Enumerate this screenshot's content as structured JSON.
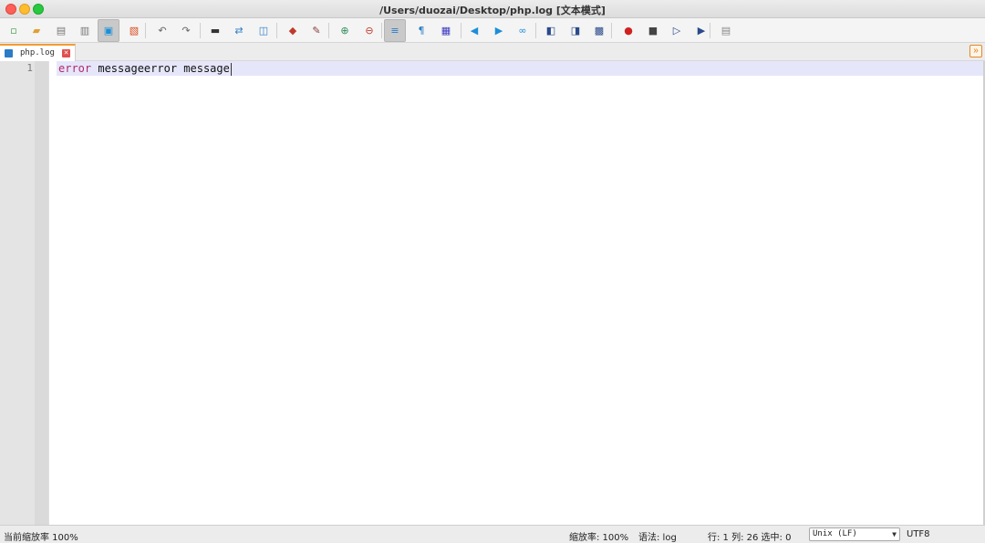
{
  "window": {
    "title": "/Users/duozai/Desktop/php.log [文本模式]"
  },
  "toolbar": {
    "buttons": [
      {
        "name": "new-file-icon",
        "glyph": "▫",
        "color": "#3a9a3a"
      },
      {
        "name": "open-file-icon",
        "glyph": "▰",
        "color": "#e0a030"
      },
      {
        "name": "save-icon",
        "glyph": "▤",
        "color": "#777777"
      },
      {
        "name": "save-all-icon",
        "glyph": "▥",
        "color": "#777777"
      },
      {
        "name": "close-file-icon",
        "glyph": "▣",
        "color": "#1b8fd8",
        "active": true
      },
      {
        "name": "close-all-icon",
        "glyph": "▧",
        "color": "#d84a20"
      },
      {
        "name": "undo-icon",
        "glyph": "↶",
        "color": "#666666"
      },
      {
        "name": "redo-icon",
        "glyph": "↷",
        "color": "#666666"
      },
      {
        "name": "print-icon",
        "glyph": "▬",
        "color": "#333333"
      },
      {
        "name": "find-replace-icon",
        "glyph": "⇄",
        "color": "#2a7cc7"
      },
      {
        "name": "bookmark-icon",
        "glyph": "◫",
        "color": "#2a7cc7"
      },
      {
        "name": "highlight-icon",
        "glyph": "◆",
        "color": "#c0392b"
      },
      {
        "name": "unmark-icon",
        "glyph": "✎",
        "color": "#8a3a3a"
      },
      {
        "name": "zoom-in-icon",
        "glyph": "⊕",
        "color": "#2e8b57"
      },
      {
        "name": "zoom-out-icon",
        "glyph": "⊖",
        "color": "#c0392b"
      },
      {
        "name": "word-wrap-icon",
        "glyph": "≡",
        "color": "#2a7cc7",
        "active": true
      },
      {
        "name": "show-all-chars-icon",
        "glyph": "¶",
        "color": "#2a7cc7"
      },
      {
        "name": "indent-guide-icon",
        "glyph": "▦",
        "color": "#3a3ac0"
      },
      {
        "name": "prev-icon",
        "glyph": "◀",
        "color": "#1b8fd8"
      },
      {
        "name": "next-icon",
        "glyph": "▶",
        "color": "#1b8fd8"
      },
      {
        "name": "goto-icon",
        "glyph": "∞",
        "color": "#1b8fd8"
      },
      {
        "name": "split-view-icon",
        "glyph": "◧",
        "color": "#2a4a8a"
      },
      {
        "name": "compare-icon",
        "glyph": "◨",
        "color": "#2a4a8a"
      },
      {
        "name": "sync-scroll-icon",
        "glyph": "▩",
        "color": "#2a4a8a"
      },
      {
        "name": "record-macro-icon",
        "glyph": "●",
        "color": "#d02020"
      },
      {
        "name": "stop-macro-icon",
        "glyph": "■",
        "color": "#444444"
      },
      {
        "name": "play-macro-icon",
        "glyph": "▷",
        "color": "#2a4a8a"
      },
      {
        "name": "run-macro-multiple-icon",
        "glyph": "▶",
        "color": "#2a4a8a"
      },
      {
        "name": "save-macro-icon",
        "glyph": "▤",
        "color": "#888888"
      }
    ]
  },
  "tabs": [
    {
      "label": "php.log"
    }
  ],
  "editor": {
    "line_number": "1",
    "content_keyword": "error",
    "content_rest": " messageerror message"
  },
  "statusbar": {
    "zoom_current": "当前缩放率 100%",
    "zoom": "缩放率: 100%",
    "syntax": "语法: log",
    "position": "行: 1 列: 26 选中: 0",
    "eol": "Unix (LF)",
    "encoding": "UTF8"
  }
}
